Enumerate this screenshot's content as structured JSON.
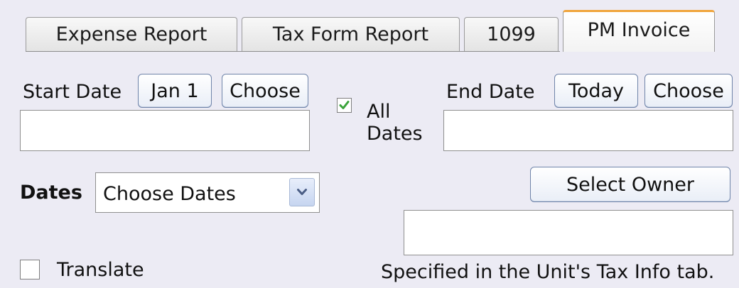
{
  "tabs": [
    {
      "label": "Expense Report",
      "active": false
    },
    {
      "label": "Tax Form Report",
      "active": false
    },
    {
      "label": "1099",
      "active": false
    },
    {
      "label": "PM Invoice",
      "active": true
    }
  ],
  "start": {
    "label": "Start Date",
    "jan1_label": "Jan 1",
    "choose_label": "Choose",
    "value": ""
  },
  "all_dates": {
    "checked": true,
    "label_line1": "All",
    "label_line2": "Dates"
  },
  "end": {
    "label": "End Date",
    "today_label": "Today",
    "choose_label": "Choose",
    "value": ""
  },
  "dates_select": {
    "label": "Dates",
    "selected": "Choose Dates"
  },
  "owner": {
    "button_label": "Select Owner",
    "value": "",
    "note": "Specified in the Unit's Tax Info tab."
  },
  "translate": {
    "label": "Translate",
    "checked": false
  },
  "colors": {
    "background": "#ecebf4",
    "active_tab_accent": "#f0a43b",
    "button_border": "#6f84a9",
    "checkmark": "#3aa33a"
  }
}
